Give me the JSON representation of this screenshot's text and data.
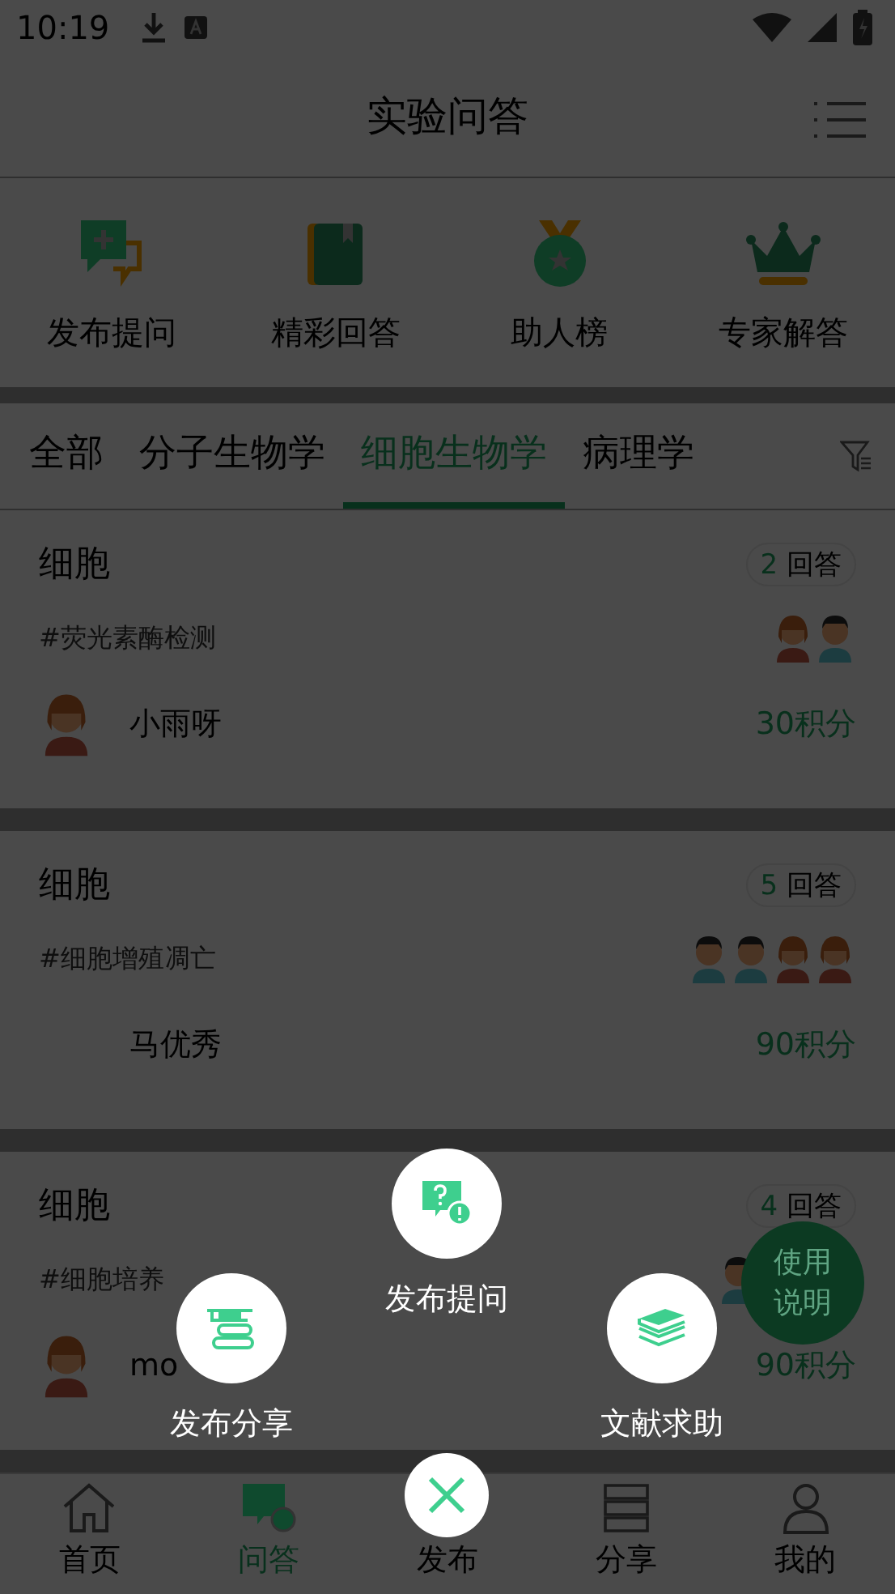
{
  "status_bar": {
    "time": "10:19"
  },
  "header": {
    "title": "实验问答"
  },
  "quick_actions": [
    {
      "label": "发布提问",
      "kind": "ask"
    },
    {
      "label": "精彩回答",
      "kind": "book"
    },
    {
      "label": "助人榜",
      "kind": "medal"
    },
    {
      "label": "专家解答",
      "kind": "crown"
    }
  ],
  "tabs": [
    {
      "label": "全部",
      "selected": false
    },
    {
      "label": "分子生物学",
      "selected": false
    },
    {
      "label": "细胞生物学",
      "selected": true
    },
    {
      "label": "病理学",
      "selected": false
    }
  ],
  "questions": [
    {
      "title": "细胞",
      "answer_count": "2",
      "answer_label": "回答",
      "tag": "#荧光素酶检测",
      "answerers": [
        {
          "kind": "female"
        },
        {
          "kind": "male"
        }
      ],
      "author": "小雨呀",
      "author_avatar": {
        "kind": "female"
      },
      "points": "30积分"
    },
    {
      "title": "细胞",
      "answer_count": "5",
      "answer_label": "回答",
      "tag": "#细胞增殖凋亡",
      "answerers": [
        {
          "kind": "male"
        },
        {
          "kind": "male"
        },
        {
          "kind": "female"
        },
        {
          "kind": "female"
        }
      ],
      "author": "马优秀",
      "points": "90积分"
    },
    {
      "title": "细胞",
      "answer_count": "4",
      "answer_label": "回答",
      "tag": "#细胞培养",
      "answerers": [
        {
          "kind": "male"
        }
      ],
      "author": "mo",
      "author_avatar": {
        "kind": "female"
      },
      "points": "90积分"
    }
  ],
  "help_button": {
    "label": "使用说明"
  },
  "publish_menu": [
    {
      "label": "发布提问",
      "kind": "question"
    },
    {
      "label": "发布分享",
      "kind": "share"
    },
    {
      "label": "文献求助",
      "kind": "literature"
    }
  ],
  "bottom_nav": [
    {
      "label": "首页",
      "kind": "home",
      "selected": false
    },
    {
      "label": "问答",
      "kind": "qa",
      "selected": true
    },
    {
      "label": "发布",
      "kind": "publish",
      "selected": false
    },
    {
      "label": "分享",
      "kind": "share",
      "selected": false
    },
    {
      "label": "我的",
      "kind": "profile",
      "selected": false
    }
  ]
}
